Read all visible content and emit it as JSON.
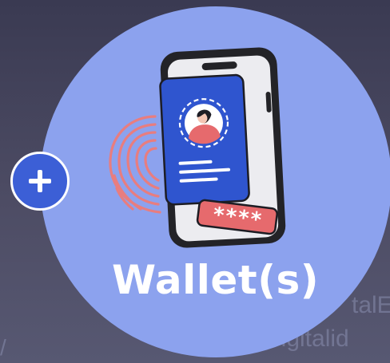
{
  "card": {
    "title": "Wallet(s)",
    "add_icon": "plus-icon",
    "illustration_icon": "phone-identity-fingerprint-icon",
    "password_mask": "****"
  },
  "background": {
    "text_1": "talE",
    "text_2": "Digitalid"
  },
  "colors": {
    "disc": "#8ca2ee",
    "add_button": "#3c5fd6",
    "id_card": "#2f55cf",
    "fingerprint": "#e87d7f",
    "password_field": "#e66a6d",
    "background": "#3f3e55"
  }
}
